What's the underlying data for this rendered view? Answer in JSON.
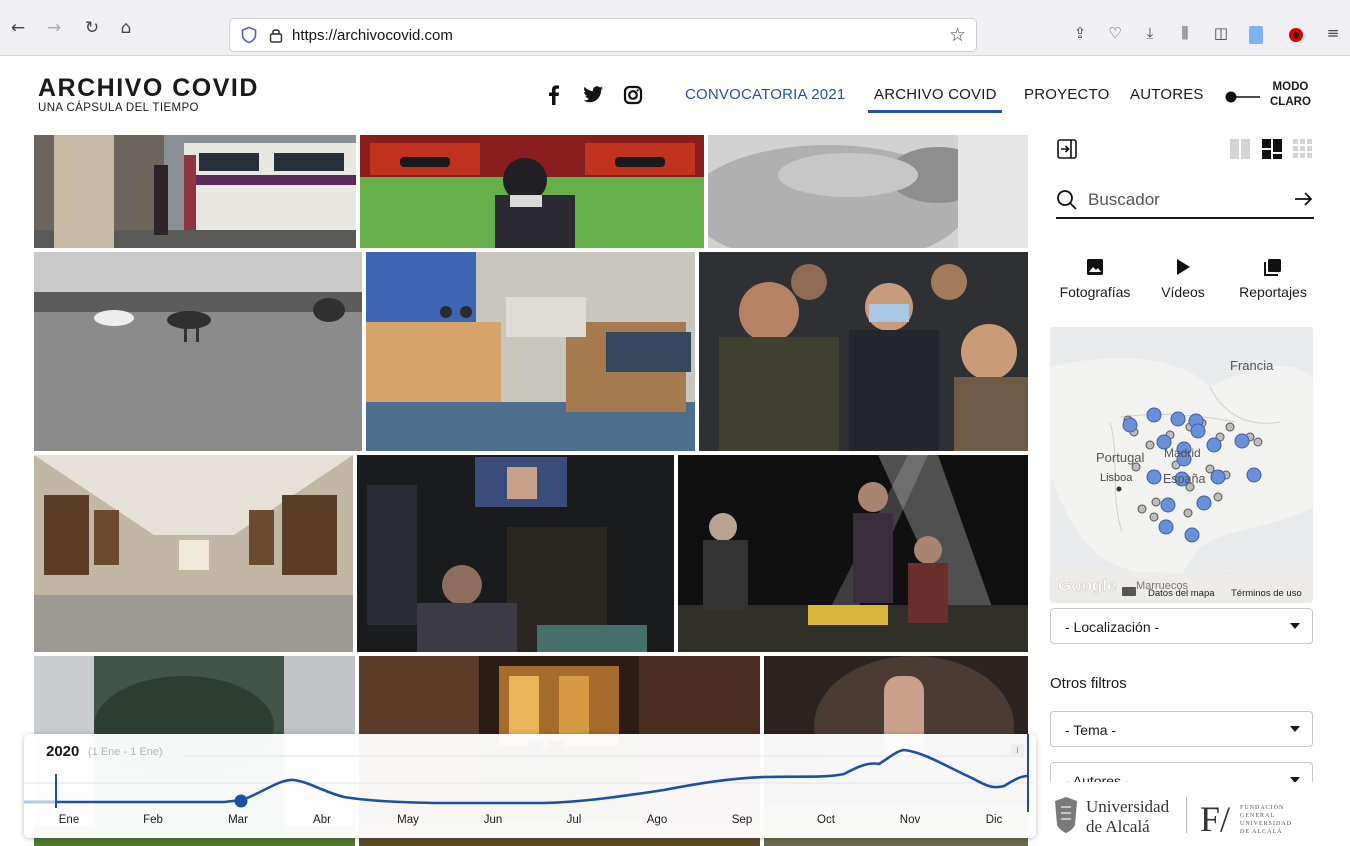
{
  "browser": {
    "url": "https://archivocovid.com"
  },
  "site": {
    "title": "ARCHIVO COVID",
    "subtitle": "UNA CÁPSULA DEL TIEMPO",
    "nav": {
      "convocatoria": "CONVOCATORIA 2021",
      "archivo": "ARCHIVO COVID",
      "proyecto": "PROYECTO",
      "autores": "AUTORES"
    },
    "mode_line1": "MODO",
    "mode_line2": "CLARO",
    "accent_color": "#2552a8"
  },
  "sidebar": {
    "search_placeholder": "Buscador",
    "media_types": {
      "photos": "Fotografías",
      "videos": "Vídeos",
      "reports": "Reportajes"
    },
    "map": {
      "labels": {
        "francia": "Francia",
        "portugal": "Portugal",
        "madrid": "Madrid",
        "espana": "España",
        "lisboa": "Lisboa",
        "marruecos": "Marruecos",
        "google": "Google",
        "map_data": "Datos del mapa",
        "terms": "Términos de uso"
      }
    },
    "location_select": "- Localización -",
    "other_filters": "Otros filtros",
    "topic_select": "- Tema -",
    "authors_select": "- Autores -",
    "logos": {
      "uah_line1": "Universidad",
      "uah_line2": "de Alcalá",
      "fund_mark": "F/",
      "fund_line1": "FUNDACIÓN",
      "fund_line2": "GENERAL",
      "fund_line3": "UNIVERSIDAD",
      "fund_line4": "DE ALCALÁ"
    }
  },
  "timeline": {
    "year": "2020",
    "range": "(1 Ene - 1 Ene)",
    "info": "i",
    "months": [
      "Ene",
      "Feb",
      "Mar",
      "Abr",
      "May",
      "Jun",
      "Jul",
      "Ago",
      "Sep",
      "Oct",
      "Nov",
      "Dic"
    ],
    "line_color": "#1c4fa8"
  }
}
